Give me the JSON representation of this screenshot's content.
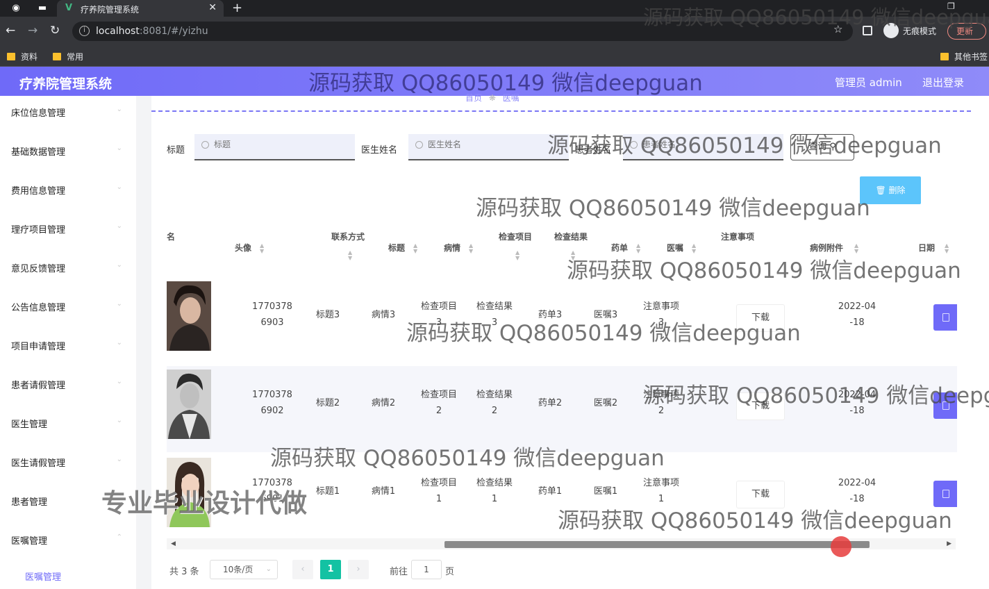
{
  "browser": {
    "tab_title": "疗养院管理系统",
    "url_host": "localhost",
    "url_rest": ":8081/#/yizhu",
    "incognito_label": "无痕模式",
    "update_label": "更新",
    "bookmarks": [
      "资料",
      "常用"
    ],
    "other_bookmarks": "其他书签"
  },
  "header": {
    "title": "疗养院管理系统",
    "admin": "管理员 admin",
    "logout": "退出登录"
  },
  "sidebar": {
    "items": [
      "床位信息管理",
      "基础数据管理",
      "费用信息管理",
      "理疗项目管理",
      "意见反馈管理",
      "公告信息管理",
      "项目申请管理",
      "患者请假管理",
      "医生管理",
      "医生请假管理",
      "患者管理",
      "医嘱管理"
    ],
    "active_sub": "医嘱管理"
  },
  "breadcrumb": {
    "home": "首页",
    "current": "医嘱"
  },
  "filters": {
    "title_label": "标题",
    "title_placeholder": "标题",
    "doctor_label": "医生姓名",
    "doctor_placeholder": "医生姓名",
    "patient_label": "患者姓名",
    "patient_placeholder": "患者姓名",
    "query": "查询",
    "delete": "删除"
  },
  "table": {
    "headers": {
      "name": "名",
      "avatar": "头像",
      "contact": "联系方式",
      "title": "标题",
      "condition": "病情",
      "exam_item": "检查项目",
      "exam_result": "检查结果",
      "prescription": "药单",
      "orders": "医嘱",
      "notes": "注意事项",
      "attachment": "病例附件",
      "date": "日期"
    },
    "rows": [
      {
        "phone_a": "1770378",
        "phone_b": "6903",
        "title": "标题3",
        "condition": "病情3",
        "exam_item_a": "检查项目",
        "exam_item_b": "3",
        "exam_result_a": "检查结果",
        "exam_result_b": "3",
        "prescription": "药单3",
        "orders": "医嘱3",
        "notes_a": "注意事项",
        "notes_b": "3",
        "download": "下载",
        "date_a": "2022-04",
        "date_b": "-18"
      },
      {
        "phone_a": "1770378",
        "phone_b": "6902",
        "title": "标题2",
        "condition": "病情2",
        "exam_item_a": "检查项目",
        "exam_item_b": "2",
        "exam_result_a": "检查结果",
        "exam_result_b": "2",
        "prescription": "药单2",
        "orders": "医嘱2",
        "notes_a": "注意事项",
        "notes_b": "2",
        "download": "下载",
        "date_a": "2022-04",
        "date_b": "-18"
      },
      {
        "phone_a": "1770378",
        "phone_b": "6901",
        "title": "标题1",
        "condition": "病情1",
        "exam_item_a": "检查项目",
        "exam_item_b": "1",
        "exam_result_a": "检查结果",
        "exam_result_b": "1",
        "prescription": "药单1",
        "orders": "医嘱1",
        "notes_a": "注意事项",
        "notes_b": "1",
        "download": "下载",
        "date_a": "2022-04",
        "date_b": "-18"
      }
    ]
  },
  "pagination": {
    "total": "共 3 条",
    "page_size": "10条/页",
    "current": "1",
    "goto": "前往",
    "goto_value": "1",
    "unit": "页"
  },
  "watermarks": {
    "source": "源码获取 QQ86050149 微信deepguan",
    "pro": "专业毕业设计代做"
  },
  "colors": {
    "accent": "#6f6af8",
    "delete": "#5cc5fb",
    "page_active": "#13c2a3"
  }
}
